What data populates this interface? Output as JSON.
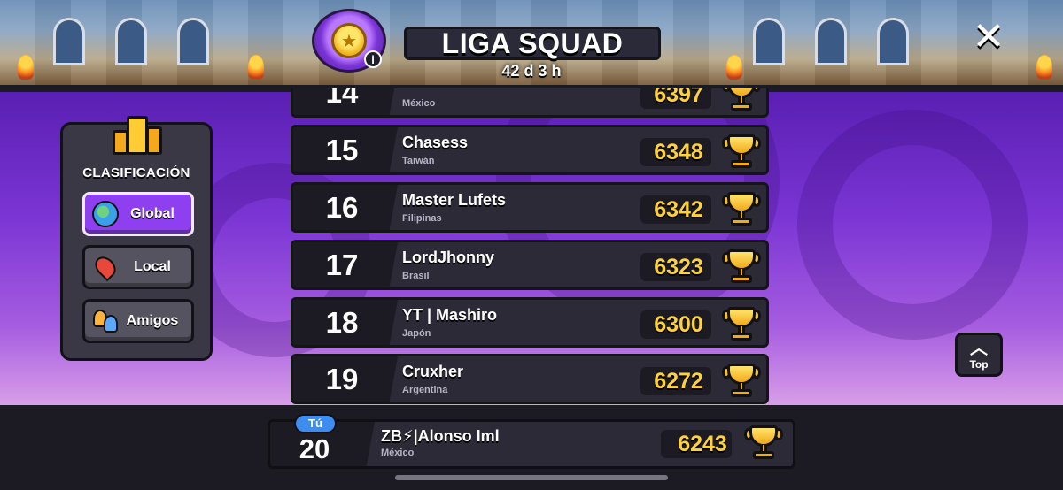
{
  "header": {
    "title": "LIGA SQUAD",
    "timer": "42 d 3 h",
    "info_label": "i",
    "close_icon": "close-icon"
  },
  "panel": {
    "title": "CLASIFICACIÓN",
    "buttons": [
      {
        "label": "Global",
        "icon": "globe-icon",
        "active": true
      },
      {
        "label": "Local",
        "icon": "map-pin-icon",
        "active": false
      },
      {
        "label": "Amigos",
        "icon": "friends-icon",
        "active": false
      }
    ]
  },
  "leaderboard": {
    "rows": [
      {
        "rank": "14",
        "name": "",
        "country": "México",
        "score": "6397"
      },
      {
        "rank": "15",
        "name": "Chasess",
        "country": "Taiwán",
        "score": "6348"
      },
      {
        "rank": "16",
        "name": "Master Lufets",
        "country": "Filipinas",
        "score": "6342"
      },
      {
        "rank": "17",
        "name": "LordJhonny",
        "country": "Brasil",
        "score": "6323"
      },
      {
        "rank": "18",
        "name": "YT | Mashiro",
        "country": "Japón",
        "score": "6300"
      },
      {
        "rank": "19",
        "name": "Cruxher",
        "country": "Argentina",
        "score": "6272"
      }
    ]
  },
  "top_button": {
    "label": "Top",
    "icon": "chevron-up-icon"
  },
  "user": {
    "you_label": "Tú",
    "rank": "20",
    "name": "ZB⚡|Alonso Iml",
    "country": "México",
    "score": "6243"
  },
  "colors": {
    "accent_purple": "#8e3ff0",
    "score_gold": "#ffd23a",
    "you_blue": "#3d8cf0"
  }
}
